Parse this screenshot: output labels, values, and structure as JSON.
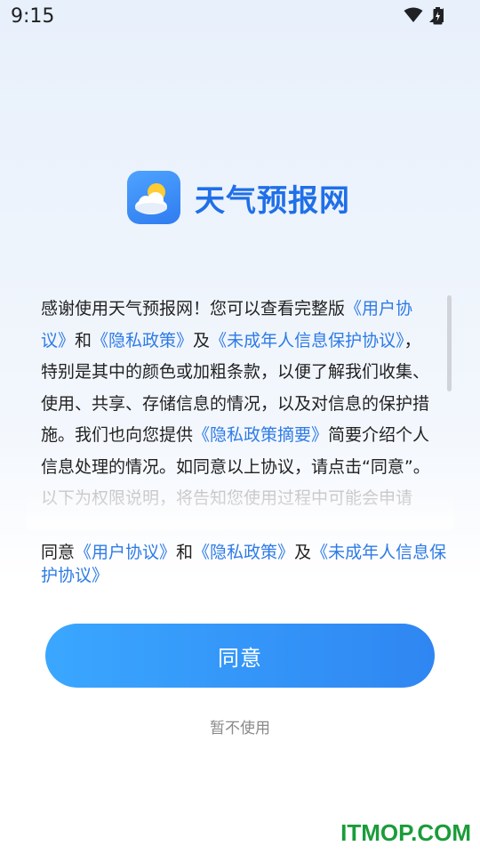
{
  "status": {
    "time": "9:15"
  },
  "app": {
    "name": "天气预报网"
  },
  "policy": {
    "p1": "感谢使用天气预报网！您可以查看完整版",
    "link_user_agreement": "《用户协议》",
    "and": "和",
    "link_privacy": "《隐私政策》",
    "ji": "及",
    "link_minor": "《未成年人信息保护协议》",
    "p2": "，特别是其中的颜色或加粗条款，以便了解我们收集、使用、共享、存储信息的情况，以及对信息的保护措施。我们也向您提供",
    "link_privacy_summary": "《隐私政策摘要》",
    "p3": "简要介绍个人信息处理的情况。如同意以上协议，请点击“同意”。",
    "p4": "以下为权限说明，将告知您使用过程中可能会申请"
  },
  "agree_line": {
    "prefix": "同意",
    "link_user_agreement": "《用户协议》",
    "and": "和",
    "link_privacy": "《隐私政策》",
    "ji": "及",
    "link_minor": "《未成年人信息保护协议》"
  },
  "buttons": {
    "agree": "同意",
    "decline": "暂不使用"
  },
  "watermark": "ITMOP.COM",
  "colors": {
    "accent": "#2e7be6",
    "button": "#2f86f2",
    "watermark": "#1a9c3a"
  }
}
